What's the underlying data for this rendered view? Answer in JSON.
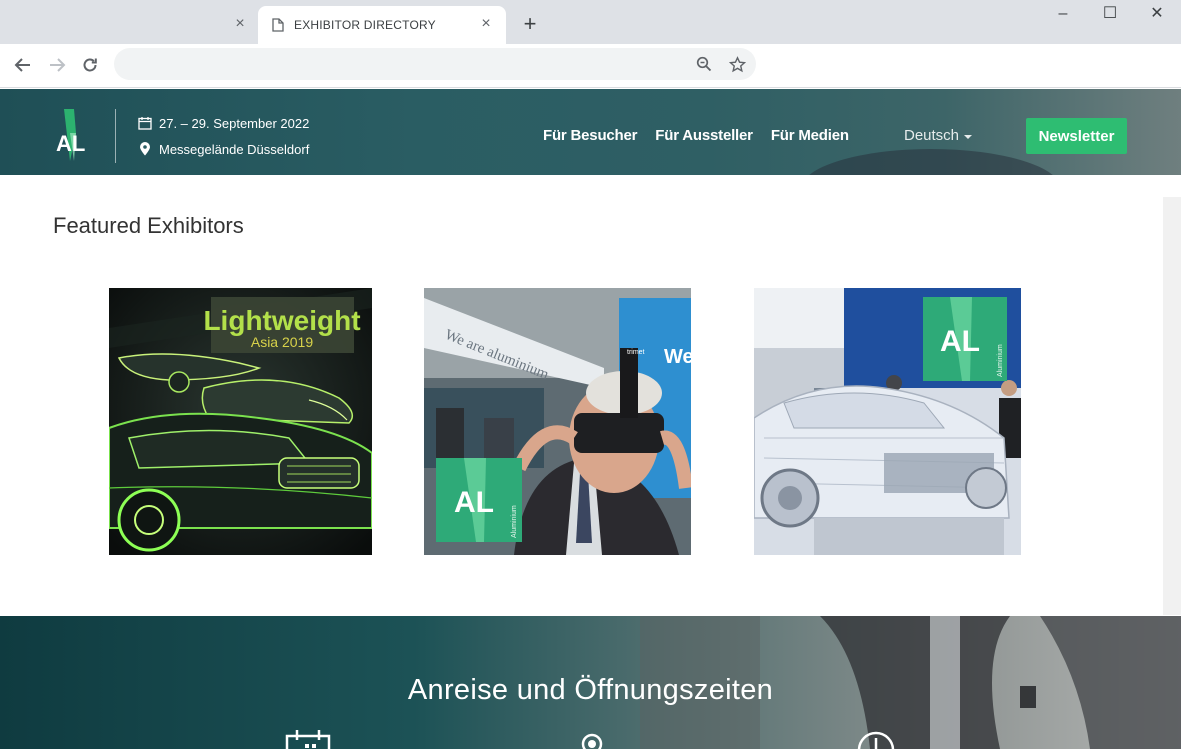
{
  "browser": {
    "inactive_tab_close": "×",
    "active_tab": {
      "title": "EXHIBITOR DIRECTORY",
      "icon": "page-icon",
      "close": "×"
    },
    "new_tab": "+",
    "window_controls": {
      "minimize": "–",
      "maximize": "☐",
      "close": "✕"
    },
    "toolbar": {
      "back_icon": "back-arrow-icon",
      "forward_icon": "forward-arrow-icon",
      "reload_icon": "reload-icon",
      "url": "",
      "zoom_icon": "zoom-icon",
      "bookmark_icon": "star-icon"
    }
  },
  "header": {
    "logo_text": "AL",
    "date": "27. – 29. September 2022",
    "location": "Messegelände Düsseldorf",
    "nav": [
      "Für Besucher",
      "Für Aussteller",
      "Für Medien"
    ],
    "language": "Deutsch",
    "newsletter": "Newsletter"
  },
  "featured": {
    "title": "Featured Exhibitors",
    "cards": [
      {
        "name": "Lightweight Asia 2019",
        "badge_line1": "Lightweight",
        "badge_line2": "Asia 2019"
      },
      {
        "name": "Aluminium VR",
        "banner_text": "We are aluminium",
        "screen_text": "We",
        "badge": "AL",
        "badge_sub": "Aluminium"
      },
      {
        "name": "Aluminium car body",
        "badge": "AL",
        "badge_sub": "Aluminium"
      }
    ]
  },
  "travel": {
    "title": "Anreise und Öffnungszeiten",
    "icons": [
      "calendar-icon",
      "location-pin-icon",
      "clock-icon"
    ]
  },
  "colors": {
    "brand_green": "#2ebd72",
    "header_teal": "#1f4f56"
  }
}
